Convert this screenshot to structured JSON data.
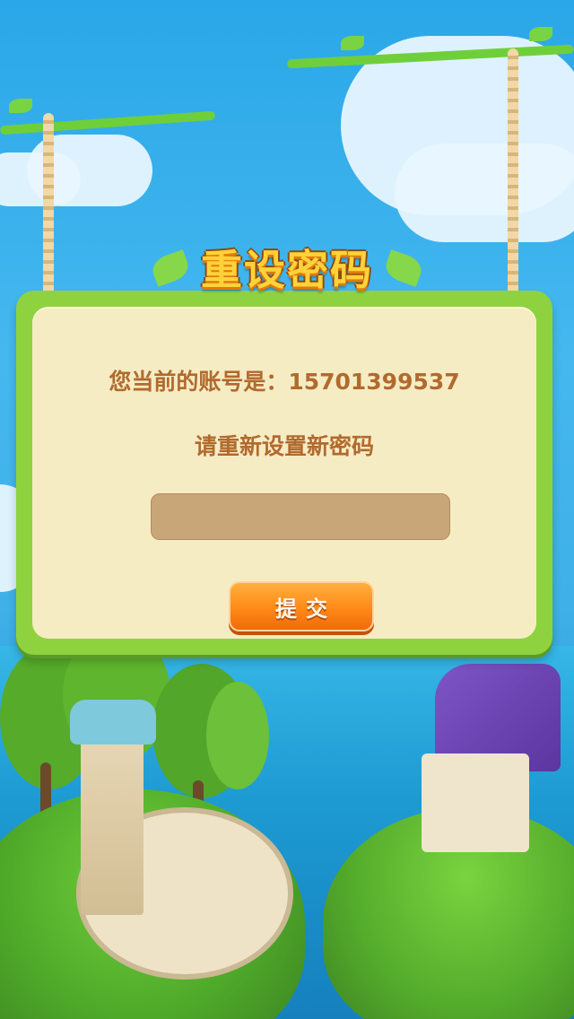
{
  "dialog": {
    "title": "重设密码",
    "account_label": "您当前的账号是：15701399537",
    "prompt": "请重新设置新密码",
    "password_value": "",
    "password_placeholder": "",
    "submit_label": "提交"
  },
  "colors": {
    "panel_border": "#8ed33f",
    "panel_fill": "#f6ecc4",
    "text_brown": "#b16a2e",
    "input_fill": "#c8a677",
    "button_orange": "#ff8a18",
    "title_yellow": "#ffd23a"
  }
}
